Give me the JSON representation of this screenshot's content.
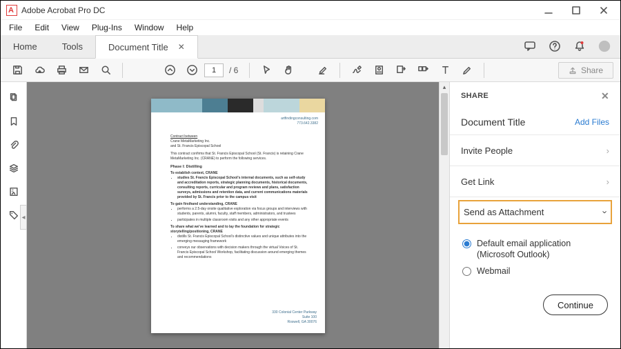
{
  "app": {
    "title": "Adobe Acrobat Pro DC"
  },
  "menus": {
    "file": "File",
    "edit": "Edit",
    "view": "View",
    "plugins": "Plug-Ins",
    "window": "Window",
    "help": "Help"
  },
  "tabs": {
    "home": "Home",
    "tools": "Tools",
    "document": "Document Title"
  },
  "toolbar": {
    "page_current": "1",
    "page_total": "/ 6",
    "share": "Share"
  },
  "share_panel": {
    "header": "SHARE",
    "doc_title": "Document Title",
    "add_files": "Add Files",
    "invite": "Invite People",
    "get_link": "Get Link",
    "send_attachment": "Send as Attachment",
    "opt_default": "Default email application (Microsoft Outlook)",
    "opt_webmail": "Webmail",
    "continue": "Continue"
  },
  "doc_preview": {
    "header_line1": "artfindingconsulting.com",
    "header_line2": "773.642.3382",
    "l1": "Contract between",
    "l2": "Crane MetaMarketing Inc.",
    "l3": "and St. Francis Episcopal School",
    "l4": "This contract confirms that St. Francis Episcopal School (St. Francis) is retaining Crane MetaMarketing Inc. (CRANE) to perform the following services.",
    "phase": "Phase I: Distilling",
    "s1_head": "To establish context, CRANE",
    "s1_b1": "studies St. Francis Episcopal School's internal documents, such as self-study and accreditation reports, strategic planning documents, historical documents, consulting reports, curricular and program reviews and plans, satisfaction surveys, admissions and retention data, and current communications materials provided by St. Francis prior to the campus visit",
    "s2_head": "To gain firsthand understanding, CRANE",
    "s2_b1": "performs a 2.5-day onsite qualitative exploration via focus groups and interviews with students, parents, alumni, faculty, staff members, administrators, and trustees",
    "s2_b2": "participates in multiple classroom visits and any other appropriate events",
    "s3_head": "To share what we've learned and to lay the foundation for strategic storytelling/positioning, CRANE",
    "s3_b1": "distills St. Francis Episcopal School's distinctive values and unique attributes into the emerging messaging framework",
    "s3_b2": "conveys our observations with decision makers through the virtual Voices of St. Francis Episcopal School Workshop, facilitating discussion around emerging themes and recommendations",
    "footer1": "330 Colonial Center Parkway",
    "footer2": "Suite 100",
    "footer3": "Roswell, GA 30076"
  }
}
